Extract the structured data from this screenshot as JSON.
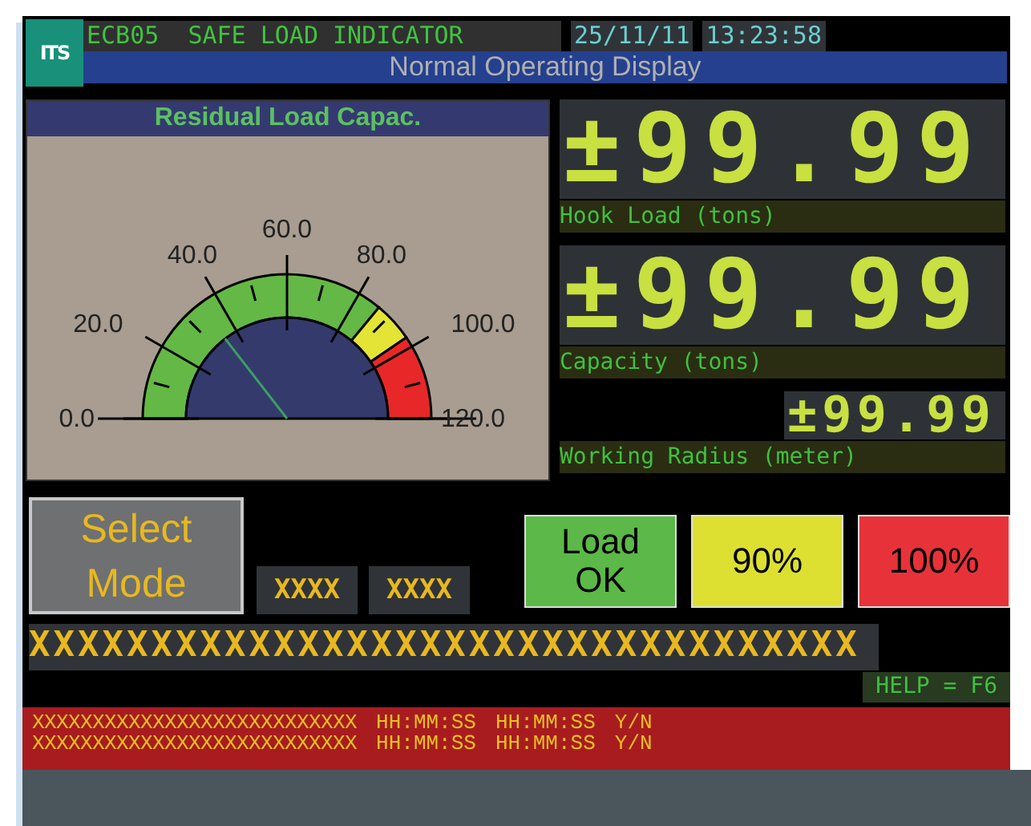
{
  "header": {
    "logo": "ITS",
    "system_label": "ECB05  SAFE LOAD INDICATOR",
    "date": "25/11/11",
    "time": "13:23:58",
    "subtitle": "Normal Operating Display"
  },
  "gauge": {
    "title": "Residual Load Capac.",
    "tick_labels": [
      "0.0",
      "20.0",
      "40.0",
      "60.0",
      "80.0",
      "100.0",
      "120.0"
    ]
  },
  "readouts": [
    {
      "kind": "large",
      "value": "±99.99",
      "label": "Hook Load (tons)"
    },
    {
      "kind": "large",
      "value": "±99.99",
      "label": "Capacity (tons)"
    },
    {
      "kind": "small",
      "value": "±99.99",
      "label": "Working Radius (meter)"
    }
  ],
  "mode_button": "Select Mode",
  "fields": [
    "XXXX",
    "XXXX"
  ],
  "status_buttons": [
    {
      "label": "Load OK",
      "color": "#5cb848"
    },
    {
      "label": "90%",
      "color": "#dde030"
    },
    {
      "label": "100%",
      "color": "#e8323a"
    }
  ],
  "message_bar": "XXXXXXXXXXXXXXXXXXXXXXXXXXXXXXXXXX",
  "help": "HELP = F6",
  "alarm_rows": [
    {
      "text": "XXXXXXXXXXXXXXXXXXXXXXXXXXX",
      "time_1": "HH:MM:SS",
      "time_2": "HH:MM:SS",
      "flag": "Y/N"
    },
    {
      "text": "XXXXXXXXXXXXXXXXXXXXXXXXXXX",
      "time_1": "HH:MM:SS",
      "time_2": "HH:MM:SS",
      "flag": "Y/N"
    }
  ]
}
